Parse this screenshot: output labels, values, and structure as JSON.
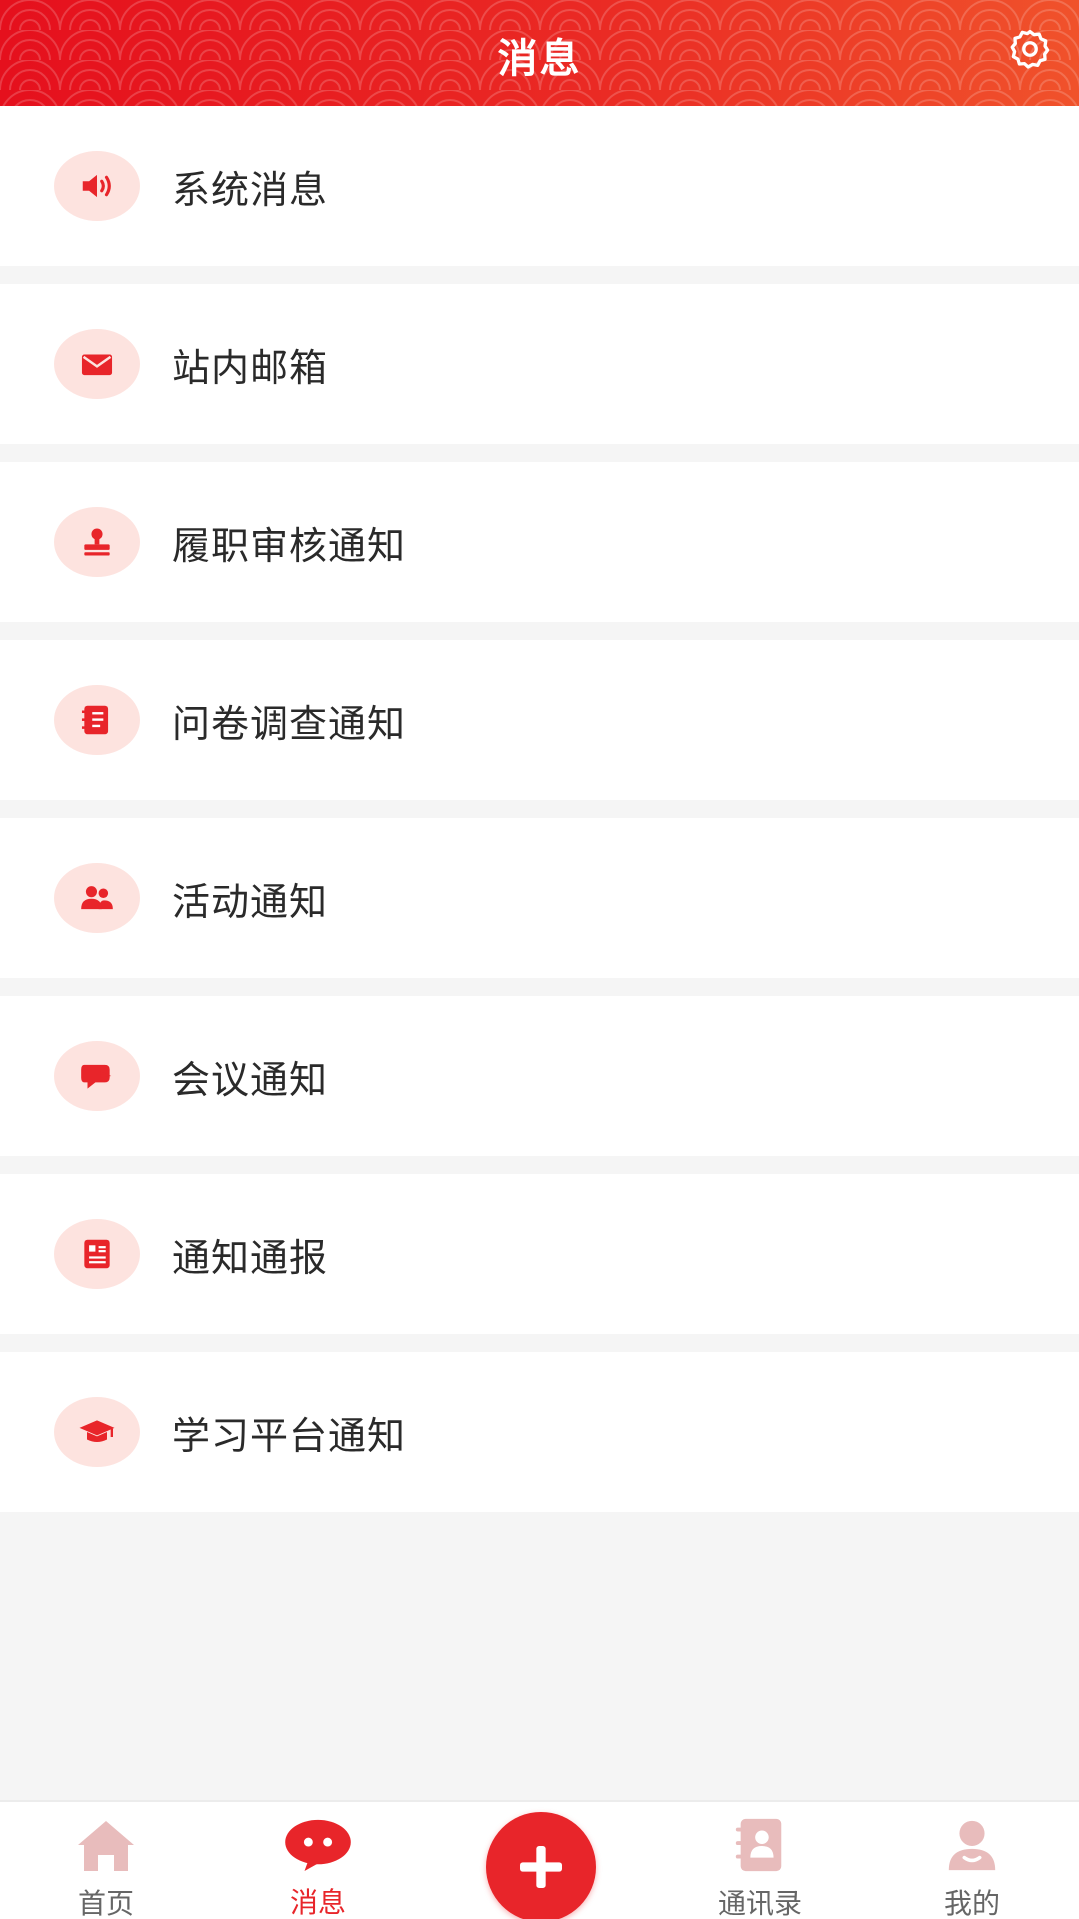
{
  "header": {
    "title": "消息",
    "settings_icon": "gear-icon"
  },
  "list": {
    "items": [
      {
        "label": "系统消息",
        "icon": "speaker-icon"
      },
      {
        "label": "站内邮箱",
        "icon": "envelope-icon"
      },
      {
        "label": "履职审核通知",
        "icon": "stamp-icon"
      },
      {
        "label": "问卷调查通知",
        "icon": "questionnaire-icon"
      },
      {
        "label": "活动通知",
        "icon": "users-icon"
      },
      {
        "label": "会议通知",
        "icon": "chat-bubble-icon"
      },
      {
        "label": "通知通报",
        "icon": "id-card-icon"
      },
      {
        "label": "学习平台通知",
        "icon": "graduation-cap-icon"
      }
    ]
  },
  "tabbar": {
    "tabs": [
      {
        "label": "首页",
        "icon": "home-icon",
        "active": false
      },
      {
        "label": "消息",
        "icon": "message-icon",
        "active": true
      },
      {
        "label": "",
        "icon": "plus-icon",
        "active": false
      },
      {
        "label": "通讯录",
        "icon": "contacts-book-icon",
        "active": false
      },
      {
        "label": "我的",
        "icon": "user-icon",
        "active": false
      }
    ]
  },
  "colors": {
    "brand_red": "#e8252a",
    "icon_bg": "#fde3df",
    "inactive_icon": "#e8bcbc",
    "page_bg": "#f5f5f5"
  }
}
